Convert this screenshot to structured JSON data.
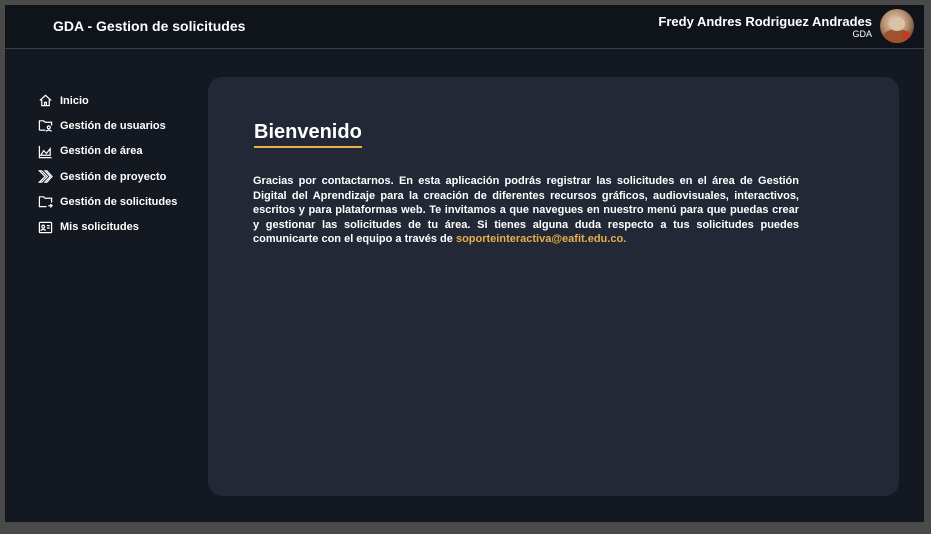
{
  "header": {
    "app_title": "GDA - Gestion de solicitudes",
    "user_name": "Fredy Andres Rodriguez Andrades",
    "user_org": "GDA"
  },
  "sidebar": {
    "items": [
      {
        "label": "Inicio",
        "icon": "home-icon"
      },
      {
        "label": "Gestión de usuarios",
        "icon": "user-folder-icon"
      },
      {
        "label": "Gestión de área",
        "icon": "area-chart-icon"
      },
      {
        "label": "Gestión de proyecto",
        "icon": "chevrons-right-icon"
      },
      {
        "label": "Gestión de solicitudes",
        "icon": "folder-arrow-icon"
      },
      {
        "label": "Mis solicitudes",
        "icon": "person-card-icon"
      }
    ]
  },
  "main": {
    "title": "Bienvenido",
    "intro_text": "Gracias por contactarnos. En esta aplicación podrás registrar las solicitudes en el área de Gestión Digital del Aprendizaje para la creación de diferentes recursos gráficos, audiovisuales, interactivos, escritos y para plataformas web. Te invitamos a que navegues en nuestro menú para que puedas crear y gestionar las solicitudes de tu área. Si tienes alguna duda respecto a tus solicitudes puedes comunicarte con el equipo a través de ",
    "email": "soporteinteractiva@eafit.edu.co."
  },
  "colors": {
    "accent": "#e8b04a",
    "background": "#141820",
    "panel": "#222836",
    "topbar": "#0f131a"
  }
}
